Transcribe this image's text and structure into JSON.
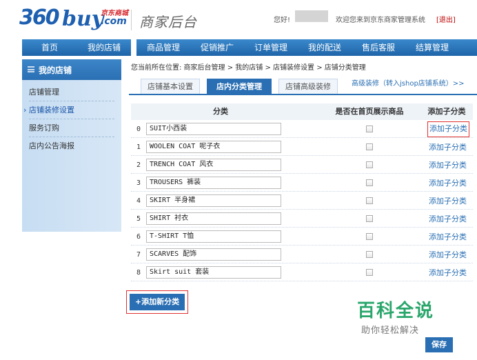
{
  "header": {
    "logo_num": "360",
    "logo_buy": "buy",
    "logo_cn": "京东商城",
    "logo_com": ".com",
    "site_title": "商家后台",
    "greeting": "您好!",
    "welcome": "欢迎您来到京东商家管理系统",
    "logout": "[退出]"
  },
  "nav": [
    "首页",
    "我的店铺",
    "商品管理",
    "促销推广",
    "订单管理",
    "我的配送",
    "售后客服",
    "结算管理"
  ],
  "sidebar": {
    "title": "我的店铺",
    "items": [
      "店铺管理",
      "店铺装修设置",
      "服务订购",
      "店内公告海报"
    ],
    "active_index": 1
  },
  "breadcrumb": "您当前所在位置: 商家后台管理 > 我的店铺 > 店铺装修设置 > 店铺分类管理",
  "tabs": {
    "items": [
      "店铺基本设置",
      "店内分类管理",
      "店铺高级装修"
    ],
    "active": "店内分类管理",
    "link": "高级装修（转入jshop店铺系统）>>"
  },
  "table": {
    "headers": {
      "category": "分类",
      "show_home": "是否在首页展示商品",
      "add_sub": "添加子分类"
    },
    "rows": [
      {
        "idx": "0",
        "name": "SUIT小西装",
        "checked": false,
        "action": "添加子分类"
      },
      {
        "idx": "1",
        "name": "WOOLEN COAT 呢子衣",
        "checked": false,
        "action": "添加子分类"
      },
      {
        "idx": "2",
        "name": "TRENCH COAT 风衣",
        "checked": false,
        "action": "添加子分类"
      },
      {
        "idx": "3",
        "name": "TROUSERS 裤装",
        "checked": false,
        "action": "添加子分类"
      },
      {
        "idx": "4",
        "name": "SKIRT 半身裙",
        "checked": false,
        "action": "添加子分类"
      },
      {
        "idx": "5",
        "name": "SHIRT 衬衣",
        "checked": false,
        "action": "添加子分类"
      },
      {
        "idx": "6",
        "name": "T-SHIRT T恤",
        "checked": false,
        "action": "添加子分类"
      },
      {
        "idx": "7",
        "name": "SCARVES 配饰",
        "checked": false,
        "action": "添加子分类"
      },
      {
        "idx": "8",
        "name": "Skirt suit 套装",
        "checked": false,
        "action": "添加子分类"
      }
    ]
  },
  "add_button": "+添加新分类",
  "save_button": "保存",
  "watermark": {
    "big": "百科全说",
    "small": "助你轻松解决"
  },
  "colors": {
    "nav": "#2a6fb3",
    "link": "#2a6fb3",
    "highlight": "#e0302f",
    "watermark": "#2aa66b"
  }
}
